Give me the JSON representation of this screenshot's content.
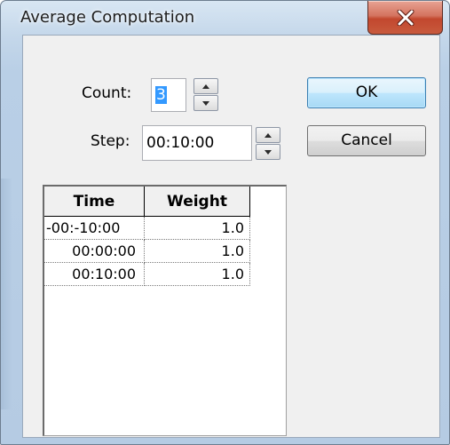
{
  "window": {
    "title": "Average Computation"
  },
  "form": {
    "count_label": "Count:",
    "count_value": "3",
    "step_label": "Step:",
    "step_value": "00:10:00"
  },
  "buttons": {
    "ok": "OK",
    "cancel": "Cancel"
  },
  "table": {
    "columns": [
      "Time",
      "Weight"
    ],
    "rows": [
      {
        "time": "-00:-10:00",
        "weight": "1.0"
      },
      {
        "time": "00:00:00",
        "weight": "1.0"
      },
      {
        "time": "00:10:00",
        "weight": "1.0"
      }
    ]
  },
  "icons": {
    "close": "close-icon",
    "spin_up": "spin-up-icon",
    "spin_down": "spin-down-icon"
  },
  "colors": {
    "selection": "#3399ff",
    "close_button": "#c85a3d",
    "default_button_border": "#3c7fb1"
  }
}
